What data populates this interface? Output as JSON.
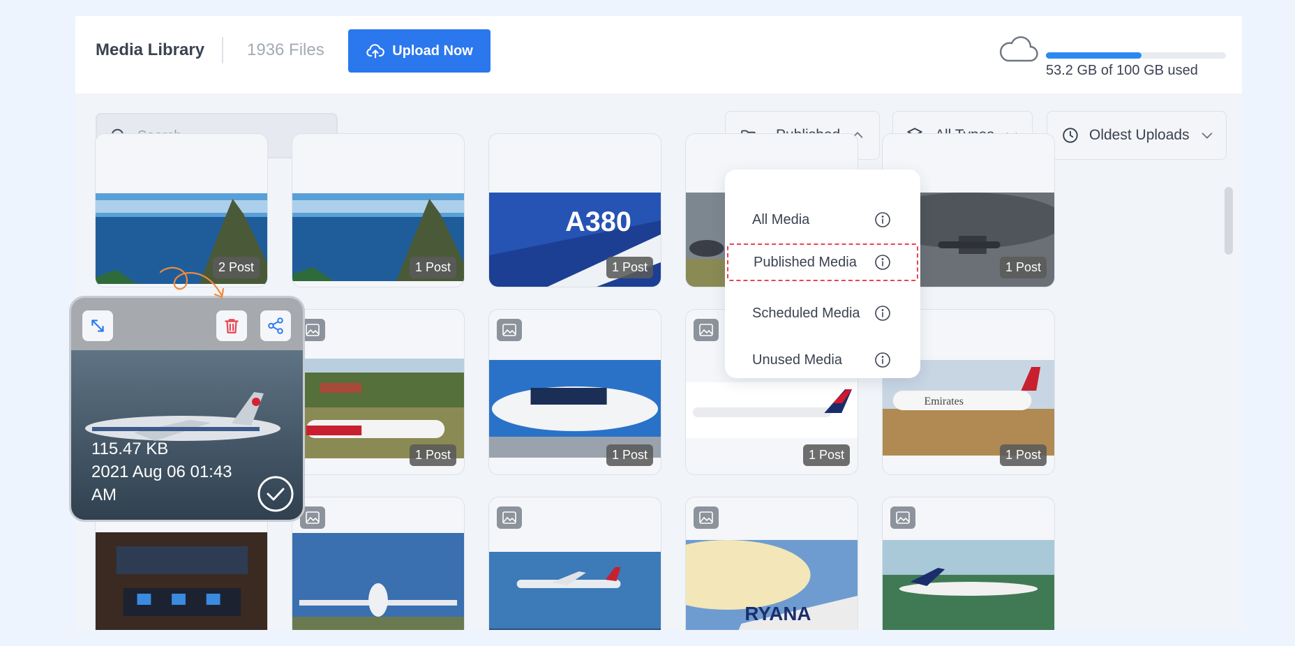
{
  "header": {
    "title": "Media Library",
    "file_count": "1936 Files",
    "upload_label": "Upload Now"
  },
  "storage": {
    "used_text": "53.2 GB of 100 GB used",
    "used_fraction": 0.532,
    "bar_color": "#2b89f0"
  },
  "search": {
    "placeholder": "Search"
  },
  "filters": {
    "status": {
      "label": "Published",
      "icon": "folder-open-icon",
      "expanded": true
    },
    "type": {
      "label": "All Types",
      "icon": "layers-icon"
    },
    "sort": {
      "label": "Oldest Uploads",
      "icon": "clock-icon"
    }
  },
  "dropdown": {
    "items": [
      {
        "label": "All Media",
        "selected": false
      },
      {
        "label": "Published Media",
        "selected": true
      },
      {
        "label": "Scheduled Media",
        "selected": false
      },
      {
        "label": "Unused Media",
        "selected": false
      }
    ]
  },
  "media_grid": {
    "row1": [
      "2 Post",
      "1 Post",
      "1 Post",
      "",
      "1 Post"
    ],
    "row2": [
      "",
      "1 Post",
      "1 Post",
      "1 Post",
      "1 Post"
    ],
    "row3": [
      "",
      "",
      "",
      "",
      ""
    ]
  },
  "hover_card": {
    "size": "115.47 KB",
    "date": "2021 Aug 06 01:43",
    "time_suffix": "AM"
  },
  "colors": {
    "accent": "#2b78ee",
    "delete": "#e7444f",
    "annotation": "#f08a3c"
  }
}
